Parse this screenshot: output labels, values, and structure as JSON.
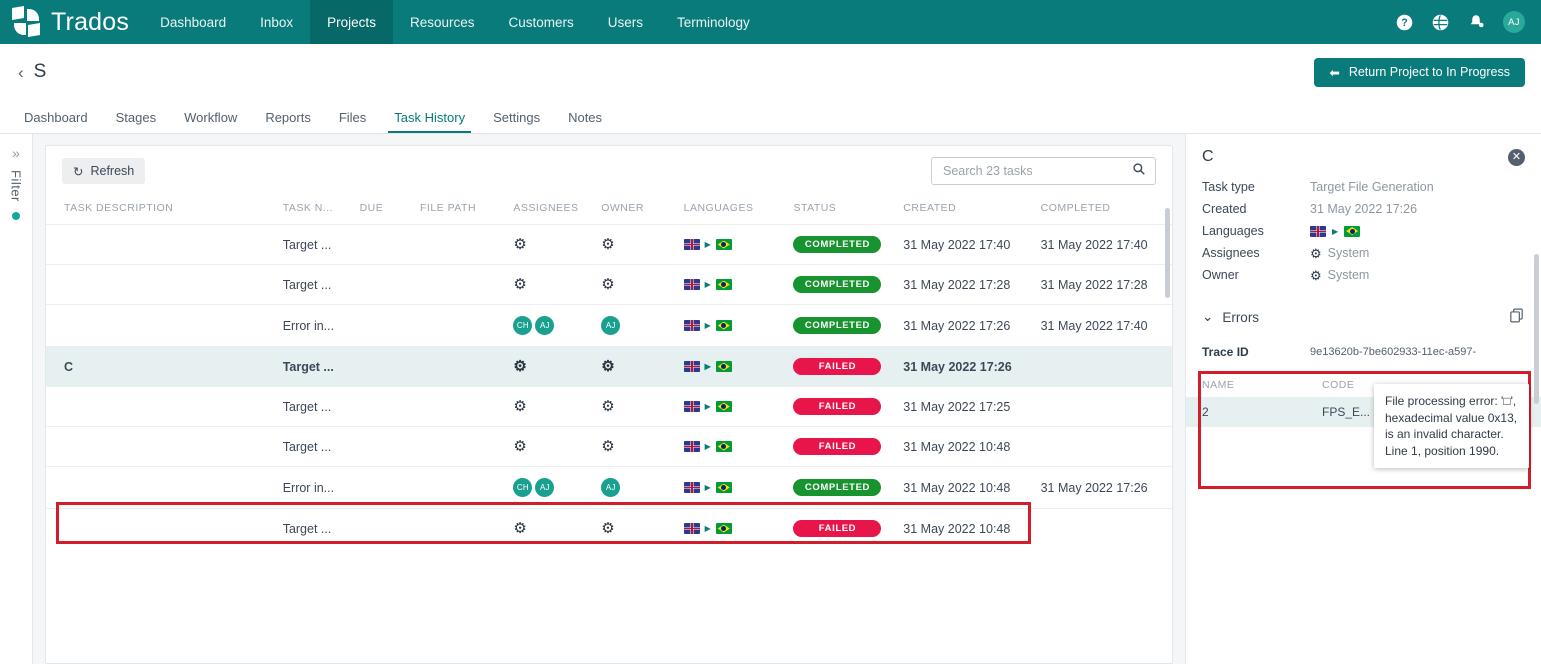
{
  "topbar": {
    "brand": "Trados",
    "nav": [
      {
        "label": "Dashboard",
        "active": false
      },
      {
        "label": "Inbox",
        "active": false
      },
      {
        "label": "Projects",
        "active": true
      },
      {
        "label": "Resources",
        "active": false
      },
      {
        "label": "Customers",
        "active": false
      },
      {
        "label": "Users",
        "active": false
      },
      {
        "label": "Terminology",
        "active": false
      }
    ],
    "icons": [
      "help-icon",
      "globe-icon",
      "notifications-bell-icon"
    ],
    "avatar_initials": "AJ",
    "bg_color": "#0a7b7b"
  },
  "project": {
    "back_label": "‹",
    "title": "S",
    "return_button": "Return Project to In Progress",
    "return_icon": "arrow-left-icon"
  },
  "tabs": [
    {
      "label": "Dashboard",
      "active": false
    },
    {
      "label": "Stages",
      "active": false
    },
    {
      "label": "Workflow",
      "active": false
    },
    {
      "label": "Reports",
      "active": false
    },
    {
      "label": "Files",
      "active": false
    },
    {
      "label": "Task History",
      "active": true
    },
    {
      "label": "Settings",
      "active": false
    },
    {
      "label": "Notes",
      "active": false
    }
  ],
  "filter_rail": {
    "expand_icon": "chevron-double-right-icon",
    "label": "Filter",
    "indicator_color": "#13a89e"
  },
  "toolbar": {
    "refresh_label": "Refresh",
    "refresh_icon": "refresh-icon",
    "search_placeholder": "Search 23 tasks",
    "search_value": "",
    "search_icon": "search-icon"
  },
  "table": {
    "columns": [
      "TASK DESCRIPTION",
      "TASK N...",
      "DUE",
      "FILE PATH",
      "ASSIGNEES",
      "OWNER",
      "LANGUAGES",
      "STATUS",
      "CREATED",
      "COMPLETED"
    ],
    "rows": [
      {
        "description": "",
        "task_name": "Target ...",
        "due": "",
        "file_path": "",
        "assignees": [
          "gear-icon"
        ],
        "owner": [
          "gear-icon"
        ],
        "source_flag": "uk",
        "target_flag": "br",
        "status": "COMPLETED",
        "created": "31 May 2022 17:40",
        "completed": "31 May 2022 17:40",
        "highlighted": false
      },
      {
        "description": "",
        "task_name": "Target ...",
        "due": "",
        "file_path": "",
        "assignees": [
          "gear-icon"
        ],
        "owner": [
          "gear-icon"
        ],
        "source_flag": "uk",
        "target_flag": "br",
        "status": "COMPLETED",
        "created": "31 May 2022 17:28",
        "completed": "31 May 2022 17:28",
        "highlighted": false
      },
      {
        "description": "",
        "task_name": "Error in...",
        "due": "",
        "file_path": "",
        "assignees": [
          "CH",
          "AJ"
        ],
        "owner": [
          "AJ"
        ],
        "source_flag": "uk",
        "target_flag": "br",
        "status": "COMPLETED",
        "created": "31 May 2022 17:26",
        "completed": "31 May 2022 17:40",
        "highlighted": false
      },
      {
        "description": "C",
        "task_name": "Target ...",
        "due": "",
        "file_path": "",
        "assignees": [
          "gear-icon"
        ],
        "owner": [
          "gear-icon"
        ],
        "source_flag": "uk",
        "target_flag": "br",
        "status": "FAILED",
        "created": "31 May 2022 17:26",
        "completed": "",
        "highlighted": true
      },
      {
        "description": "",
        "task_name": "Target ...",
        "due": "",
        "file_path": "",
        "assignees": [
          "gear-icon"
        ],
        "owner": [
          "gear-icon"
        ],
        "source_flag": "uk",
        "target_flag": "br",
        "status": "FAILED",
        "created": "31 May 2022 17:25",
        "completed": "",
        "highlighted": false
      },
      {
        "description": "",
        "task_name": "Target ...",
        "due": "",
        "file_path": "",
        "assignees": [
          "gear-icon"
        ],
        "owner": [
          "gear-icon"
        ],
        "source_flag": "uk",
        "target_flag": "br",
        "status": "FAILED",
        "created": "31 May 2022 10:48",
        "completed": "",
        "highlighted": false
      },
      {
        "description": "",
        "task_name": "Error in...",
        "due": "",
        "file_path": "",
        "assignees": [
          "CH",
          "AJ"
        ],
        "owner": [
          "AJ"
        ],
        "source_flag": "uk",
        "target_flag": "br",
        "status": "COMPLETED",
        "created": "31 May 2022 10:48",
        "completed": "31 May 2022 17:26",
        "highlighted": false
      },
      {
        "description": "",
        "task_name": "Target ...",
        "due": "",
        "file_path": "",
        "assignees": [
          "gear-icon"
        ],
        "owner": [
          "gear-icon"
        ],
        "source_flag": "uk",
        "target_flag": "br",
        "status": "FAILED",
        "created": "31 May 2022 10:48",
        "completed": "",
        "highlighted": false
      }
    ],
    "status_colors": {
      "COMPLETED": "#17932f",
      "FAILED": "#e8154a"
    }
  },
  "detail": {
    "title": "C",
    "close_icon": "close-icon",
    "fields": [
      {
        "label": "Task type",
        "value": "Target File Generation",
        "type": "text"
      },
      {
        "label": "Created",
        "value": "31 May 2022 17:26",
        "type": "text"
      },
      {
        "label": "Languages",
        "value": "",
        "type": "flags"
      },
      {
        "label": "Assignees",
        "value": "System",
        "type": "gear-text"
      },
      {
        "label": "Owner",
        "value": "System",
        "type": "gear-text"
      }
    ],
    "errors": {
      "section_label": "Errors",
      "collapse_icon": "chevron-down-icon",
      "copy_icon": "copy-icon",
      "trace_label": "Trace ID",
      "trace_value": "9e13620b-7be602933-11ec-a597-",
      "columns": [
        "NAME",
        "CODE",
        ""
      ],
      "rows": [
        {
          "name": "2",
          "code": "FPS_E...",
          "message": "File processing err..."
        }
      ]
    },
    "tooltip": "File processing error: '□', hexadecimal value 0x13, is an invalid character. Line 1, position 1990."
  },
  "annotations": {
    "highlight_color": "#d11e2a"
  }
}
